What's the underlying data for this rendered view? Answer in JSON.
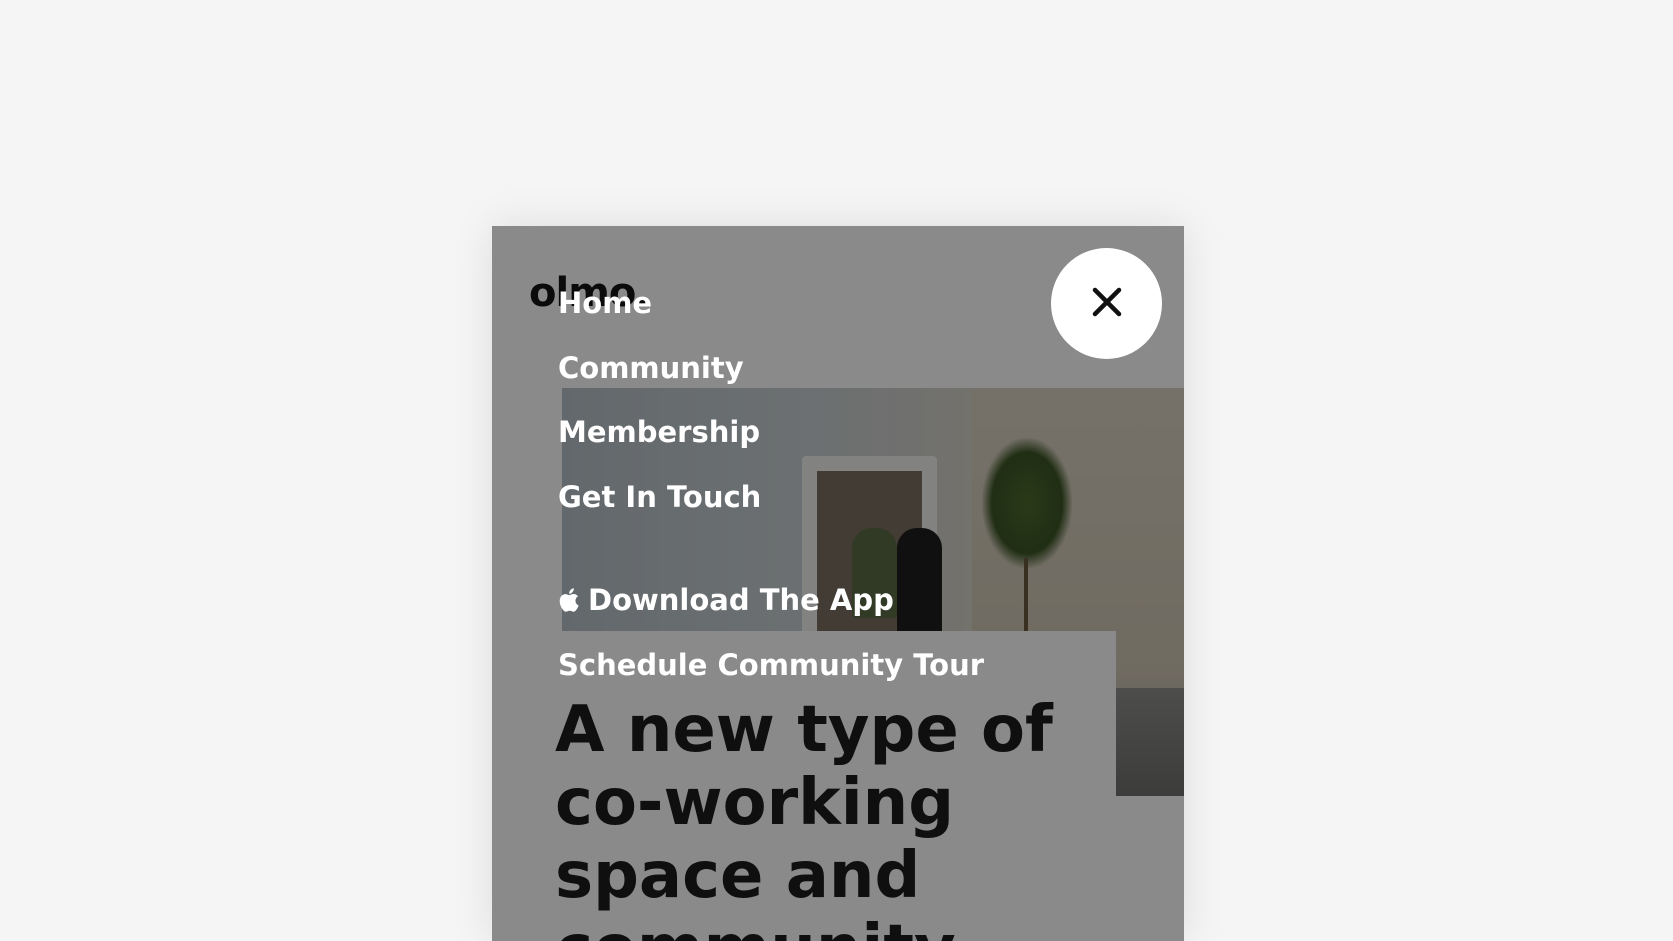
{
  "brand": {
    "logo_text": "olmo."
  },
  "hero": {
    "headline": "A new type of co-working space and community"
  },
  "menu": {
    "items": [
      {
        "label": "Home"
      },
      {
        "label": "Community"
      },
      {
        "label": "Membership"
      },
      {
        "label": "Get In Touch"
      }
    ],
    "download_app": {
      "label": "Download The App",
      "icon": "apple-icon"
    },
    "schedule_tour": {
      "label": "Schedule Community Tour"
    },
    "close": {
      "icon": "close-icon"
    }
  },
  "colors": {
    "page_background": "#f5f5f5",
    "overlay": "rgba(0,0,0,0.46)",
    "menu_text": "#ffffff",
    "headline_text": "#1d1d1d"
  }
}
